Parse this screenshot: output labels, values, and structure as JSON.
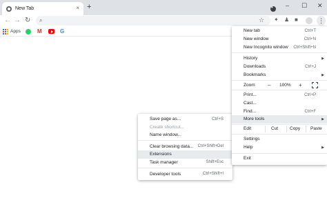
{
  "tab": {
    "title": "New Tab",
    "close": "×",
    "new": "+"
  },
  "window": {
    "minimize": "–",
    "maximize": "☐",
    "close": "✕"
  },
  "toolbar": {
    "back": "←",
    "forward": "→",
    "reload": "↻",
    "search": "🔍",
    "star": "☆",
    "menu": "⋮"
  },
  "bookmarks": {
    "apps": "Apps",
    "gmail": "M",
    "google": "G"
  },
  "main_menu": {
    "new_tab": "New tab",
    "new_tab_sc": "Ctrl+T",
    "new_window": "New window",
    "new_window_sc": "Ctrl+N",
    "incognito": "New Incognito window",
    "incognito_sc": "Ctrl+Shift+N",
    "history": "History",
    "downloads": "Downloads",
    "downloads_sc": "Ctrl+J",
    "bookmarks": "Bookmarks",
    "zoom": "Zoom",
    "zoom_minus": "–",
    "zoom_value": "100%",
    "zoom_plus": "+",
    "print": "Print...",
    "print_sc": "Ctrl+P",
    "cast": "Cast...",
    "find": "Find...",
    "find_sc": "Ctrl+F",
    "more_tools": "More tools",
    "edit": "Edit",
    "cut": "Cut",
    "copy": "Copy",
    "paste": "Paste",
    "settings": "Settings",
    "help": "Help",
    "exit": "Exit",
    "arrow": "▶"
  },
  "sub_menu": {
    "save_page": "Save page as...",
    "save_page_sc": "Ctrl+S",
    "create_shortcut": "Create shortcut...",
    "name_window": "Name window...",
    "clear_browsing": "Clear browsing data...",
    "clear_browsing_sc": "Ctrl+Shift+Del",
    "extensions": "Extensions",
    "task_manager": "Task manager",
    "task_manager_sc": "Shift+Esc",
    "dev_tools": "Developer tools",
    "dev_tools_sc": "Ctrl+Shift+I"
  }
}
